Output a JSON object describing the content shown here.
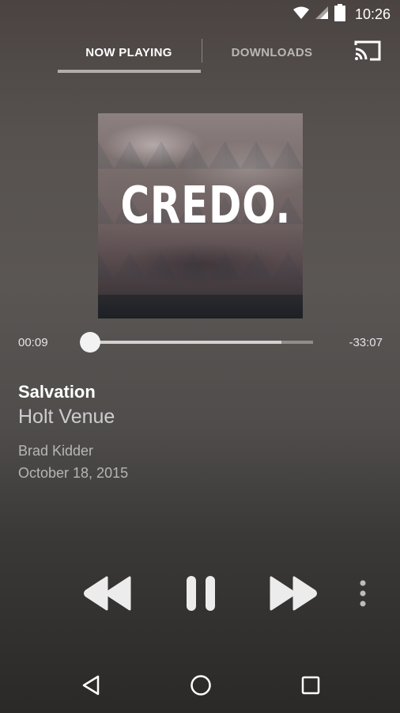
{
  "status_bar": {
    "time": "10:26",
    "icons": [
      "wifi-icon",
      "cellular-signal-icon",
      "battery-icon"
    ]
  },
  "tabs": [
    {
      "label": "NOW PLAYING",
      "selected": true
    },
    {
      "label": "DOWNLOADS",
      "selected": false
    }
  ],
  "header": {
    "cast_icon": "cast-icon"
  },
  "album_art": {
    "title": "CREDO."
  },
  "player": {
    "elapsed": "00:09",
    "remaining": "-33:07",
    "progress_fraction": 0.004,
    "buffered_fraction": 0.86
  },
  "track": {
    "title": "Salvation",
    "venue": "Holt Venue",
    "speaker": "Brad Kidder",
    "date": "October 18, 2015"
  },
  "controls": {
    "icons": [
      "rewind-icon",
      "pause-icon",
      "fast-forward-icon",
      "more-vert-icon"
    ]
  },
  "nav": {
    "icons": [
      "back-icon",
      "home-icon",
      "recents-icon"
    ]
  },
  "colors": {
    "background_top": "#4a4341",
    "background_bottom": "#2a2928",
    "text_primary": "#ffffff"
  }
}
